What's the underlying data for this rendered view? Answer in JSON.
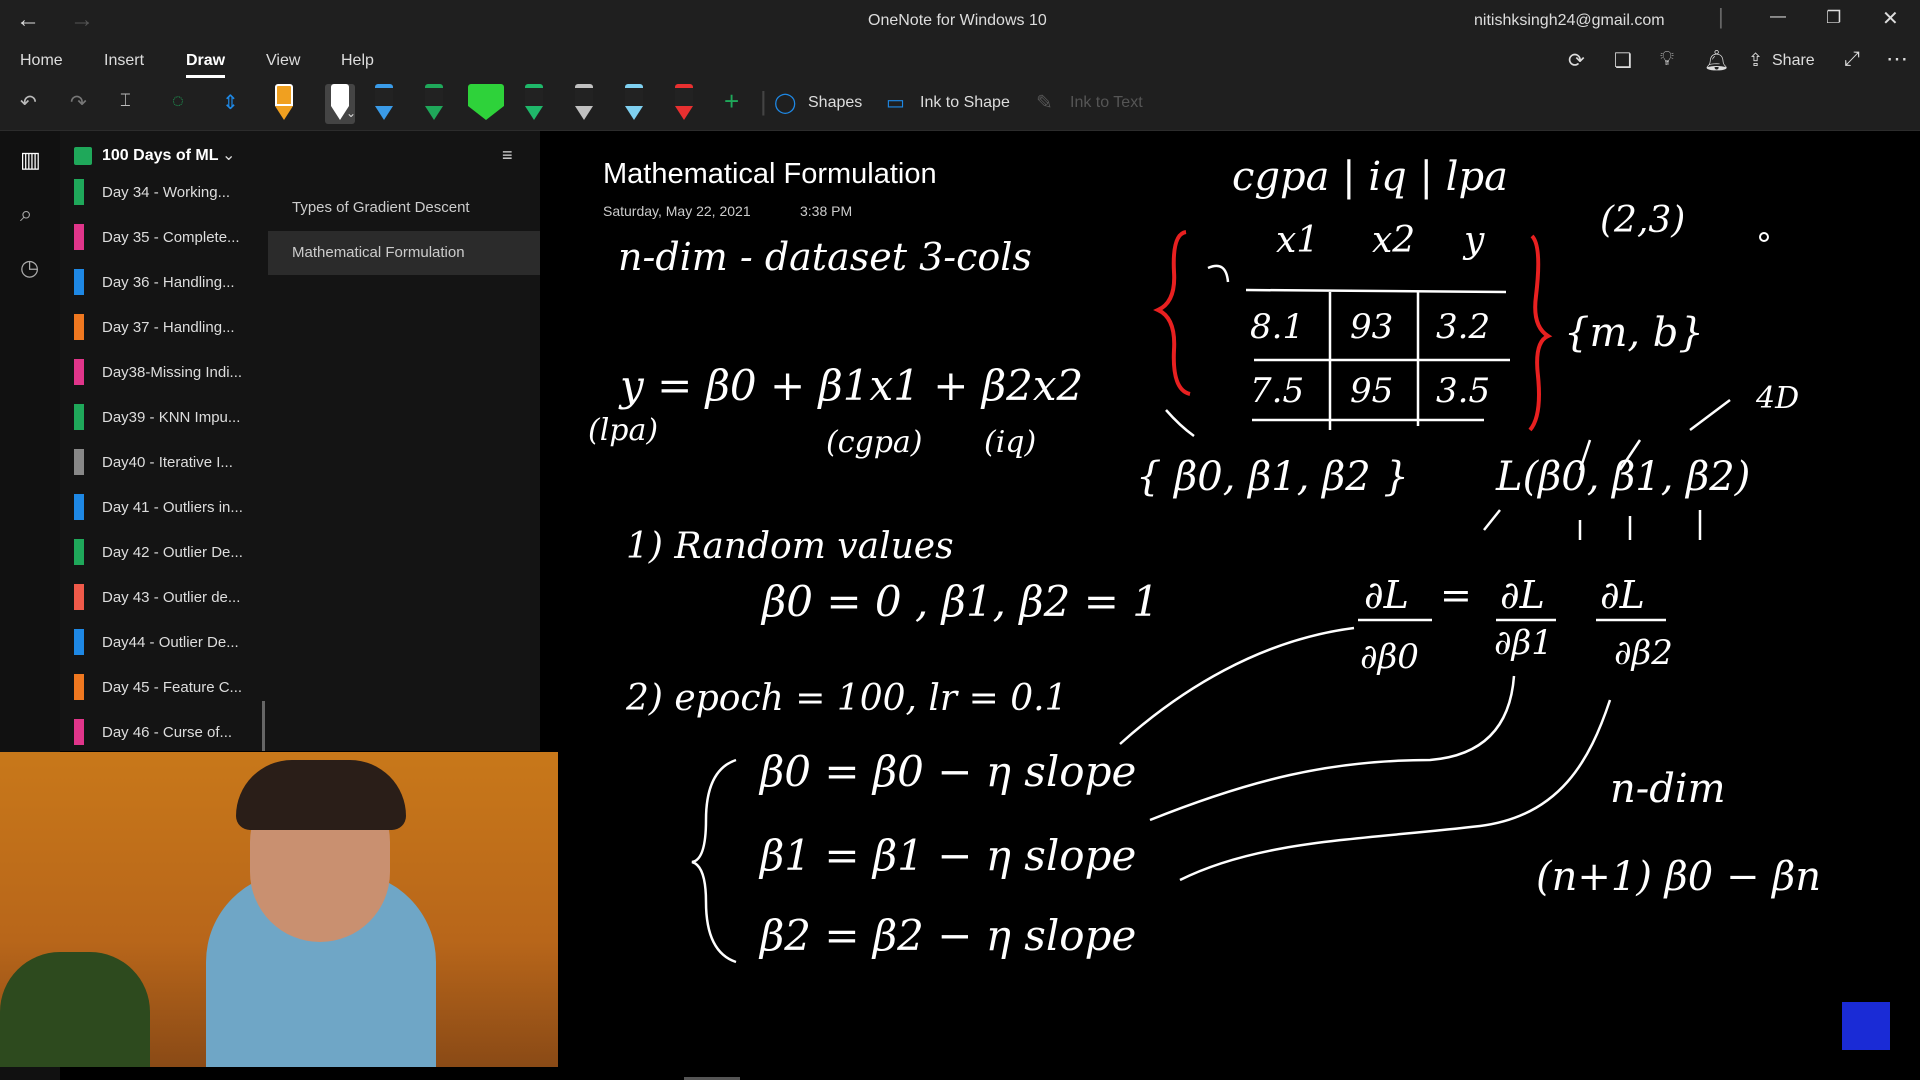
{
  "titlebar": {
    "app_title": "OneNote for Windows 10",
    "account": "nitishksingh24@gmail.com"
  },
  "menu": {
    "home": "Home",
    "insert": "Insert",
    "draw": "Draw",
    "view": "View",
    "help": "Help",
    "share": "Share"
  },
  "toolbar": {
    "shapes": "Shapes",
    "ink_to_shape": "Ink to Shape",
    "ink_to_text": "Ink to Text",
    "pen_colors": [
      "#f0a020",
      "#ffffff",
      "#3a9be8",
      "#1fa85a",
      "#2ed23a",
      "#1fb86a",
      "#c0c0c0",
      "#7fd0f0",
      "#e83030"
    ]
  },
  "notebook": {
    "name": "100 Days of ML",
    "sections": [
      {
        "label": "Day 34 - Working...",
        "color": "#1fa85a"
      },
      {
        "label": "Day 35 - Complete...",
        "color": "#e0358a"
      },
      {
        "label": "Day 36 - Handling...",
        "color": "#1e88e5"
      },
      {
        "label": "Day 37 - Handling...",
        "color": "#f07820"
      },
      {
        "label": "Day38-Missing Indi...",
        "color": "#e0358a"
      },
      {
        "label": "Day39 - KNN Impu...",
        "color": "#1fa85a"
      },
      {
        "label": "Day40 - Iterative I...",
        "color": "#888888"
      },
      {
        "label": "Day 41 - Outliers in...",
        "color": "#1e88e5"
      },
      {
        "label": "Day 42 - Outlier De...",
        "color": "#1fa85a"
      },
      {
        "label": "Day 43 - Outlier de...",
        "color": "#f05a4a"
      },
      {
        "label": "Day44 - Outlier De...",
        "color": "#1e88e5"
      },
      {
        "label": "Day 45 - Feature C...",
        "color": "#f07820"
      },
      {
        "label": "Day 46 - Curse of...",
        "color": "#e0358a"
      }
    ]
  },
  "pages": [
    {
      "label": "Types of Gradient Descent",
      "selected": false
    },
    {
      "label": "Mathematical Formulation",
      "selected": true
    }
  ],
  "page": {
    "title": "Mathematical Formulation",
    "date": "Saturday, May 22, 2021",
    "time": "3:38 PM"
  },
  "ink": {
    "header": "cgpa | iq | lpa",
    "point": "(2,3)",
    "dataset": "n-dim - dataset 3-cols",
    "eq_y": "y = β0 + β1x1 + β2x2",
    "eq_labels": [
      "(lpa)",
      "(cgpa)",
      "(iq)"
    ],
    "table_cols": [
      "x1",
      "x2",
      "y"
    ],
    "table_rows": [
      [
        "8.1",
        "93",
        "3.2"
      ],
      [
        "7.5",
        "95",
        "3.5"
      ]
    ],
    "mb": "{m, b}",
    "betas": "{ β0, β1, β2 }",
    "loss": "L(β0, β1, β2)",
    "four_d": "4D",
    "step1": "1) Random values",
    "init": "β0 = 0 ,  β1, β2 = 1",
    "step2": "2) epoch = 100, lr = 0.1",
    "updates": [
      "β0 = β0 − η slope",
      "β1 = β1 − η slope",
      "β2 = β2 − η slope"
    ],
    "grad_lhs": "∂L",
    "grad_parts": [
      "∂β0",
      "∂β1",
      "∂β2"
    ],
    "ndim": "n-dim",
    "nplus": "(n+1)  β0 − βn"
  }
}
